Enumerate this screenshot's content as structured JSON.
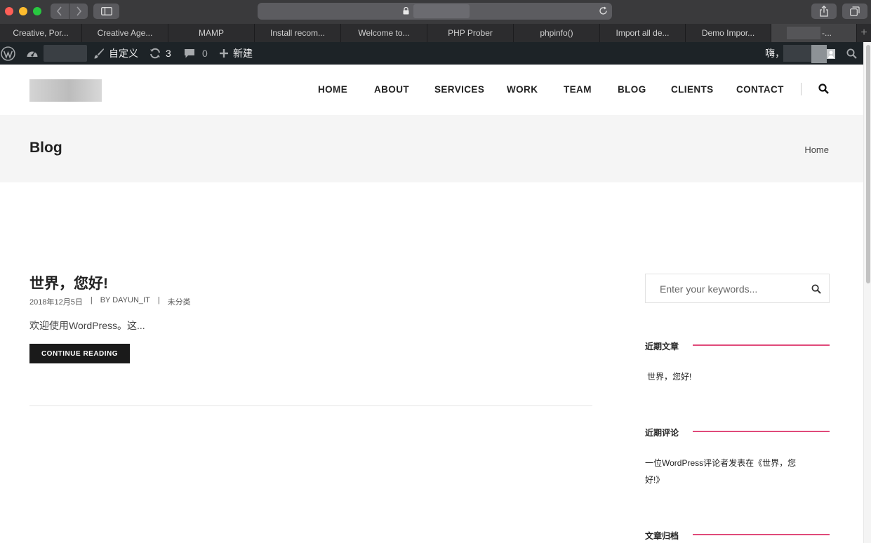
{
  "browser": {
    "tabs": [
      {
        "label": "Creative, Por..."
      },
      {
        "label": "Creative Age..."
      },
      {
        "label": "MAMP"
      },
      {
        "label": "Install recom..."
      },
      {
        "label": "Welcome to..."
      },
      {
        "label": "PHP Prober"
      },
      {
        "label": "phpinfo()"
      },
      {
        "label": "Import all de..."
      },
      {
        "label": "Demo Impor..."
      },
      {
        "label": "-..."
      }
    ]
  },
  "admin_bar": {
    "customize_label": "自定义",
    "updates_count": "3",
    "comments_count": "0",
    "new_label": "新建",
    "greeting": "嗨，"
  },
  "nav": {
    "items": [
      "HOME",
      "ABOUT",
      "SERVICES",
      "WORK",
      "TEAM",
      "BLOG",
      "CLIENTS",
      "CONTACT"
    ]
  },
  "page": {
    "title": "Blog",
    "breadcrumb": "Home"
  },
  "post": {
    "title": "世界，您好!",
    "date": "2018年12月5日",
    "author": "BY DAYUN_IT",
    "category": "未分类",
    "separator": "|",
    "excerpt": "欢迎使用WordPress。这...",
    "cta_label": "CONTINUE READING"
  },
  "sidebar": {
    "search_placeholder": "Enter your keywords...",
    "recent_posts_title": "近期文章",
    "recent_post_item": "世界，您好!",
    "recent_comments_title": "近期评论",
    "recent_comment_line1": "一位WordPress评论者发表在《世界，您",
    "recent_comment_line2": "好!》",
    "archives_title": "文章归档",
    "accent_color": "#e04a7a"
  }
}
